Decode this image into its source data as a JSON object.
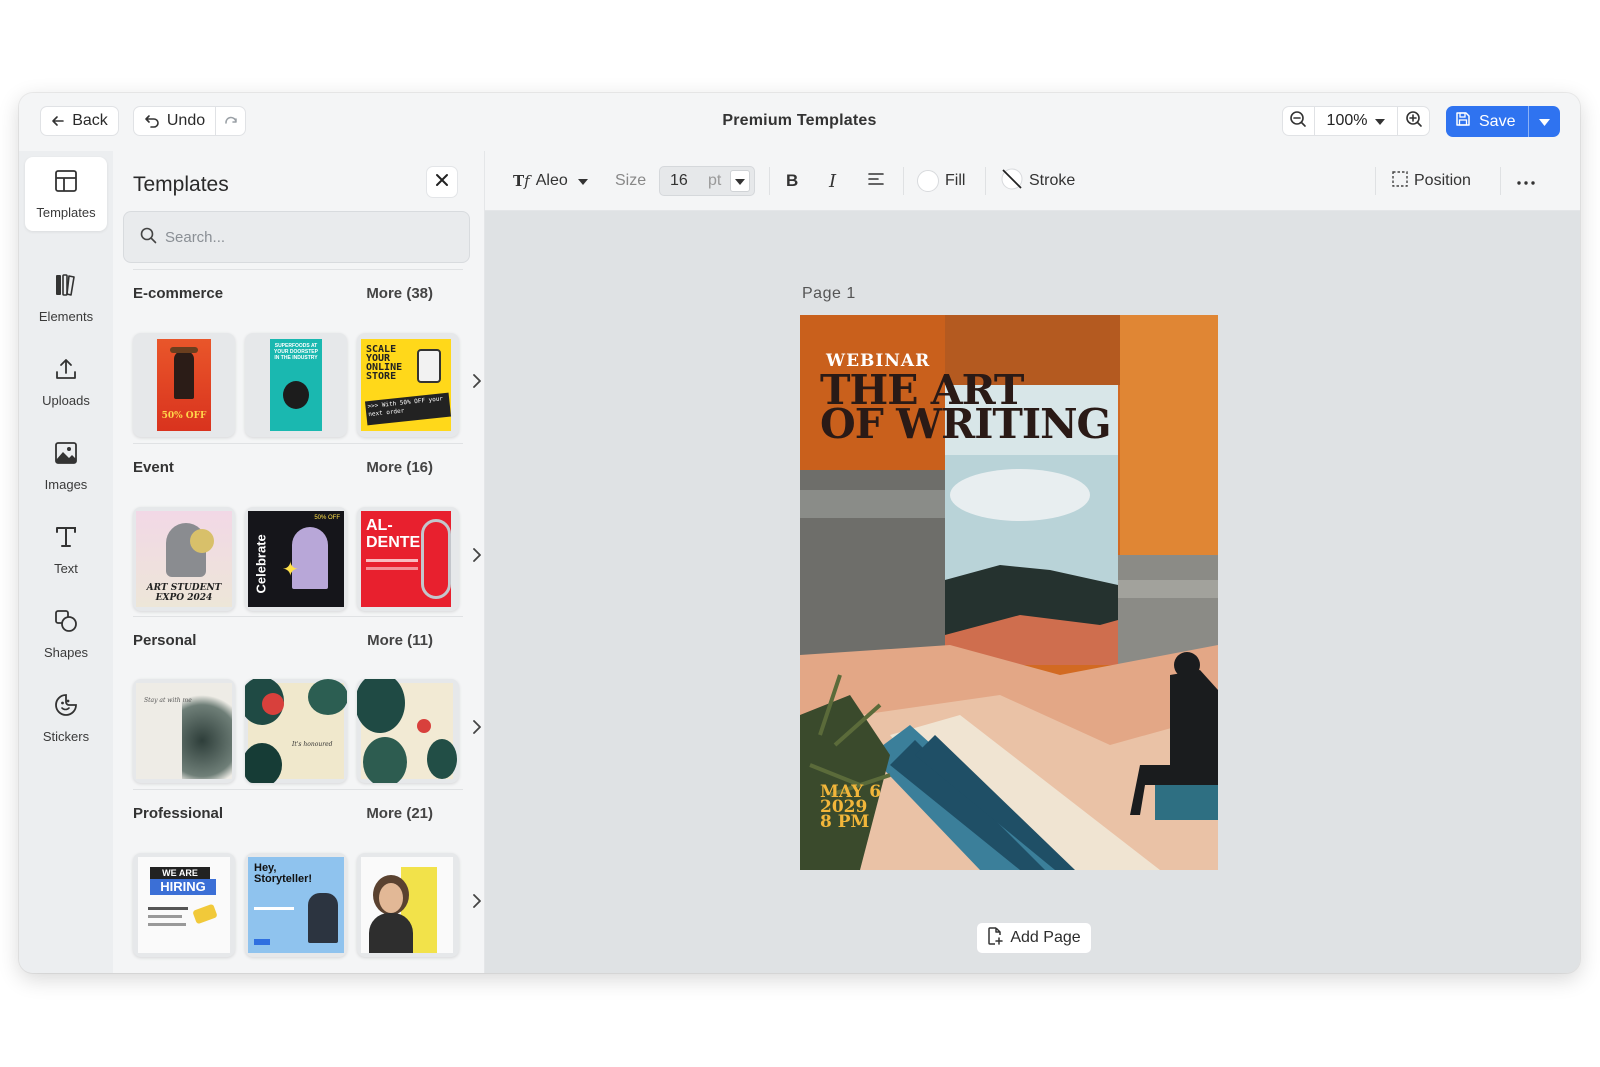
{
  "app": {
    "title": "Premium Templates",
    "back_label": "Back",
    "undo_label": "Undo",
    "zoom_value": "100%",
    "save_label": "Save",
    "accent_color": "#2f73f0"
  },
  "rail": {
    "items": [
      {
        "label": "Templates",
        "icon": "layout-icon",
        "active": true
      },
      {
        "label": "Elements",
        "icon": "elements-icon"
      },
      {
        "label": "Uploads",
        "icon": "upload-icon"
      },
      {
        "label": "Images",
        "icon": "image-icon"
      },
      {
        "label": "Text",
        "icon": "text-icon"
      },
      {
        "label": "Shapes",
        "icon": "shapes-icon"
      },
      {
        "label": "Stickers",
        "icon": "sticker-icon"
      }
    ]
  },
  "panel": {
    "title": "Templates",
    "search_placeholder": "Search...",
    "sections": [
      {
        "name": "E-commerce",
        "more": "More (38)",
        "thumbs": [
          {
            "text": "50% OFF"
          },
          {
            "text": "SUPERFOODS AT YOUR DOORSTEP IN THE INDUSTRY"
          },
          {
            "text": "SCALE YOUR ONLINE STORE",
            "sub": ">>> With 50% OFF your next order"
          }
        ]
      },
      {
        "name": "Event",
        "more": "More (16)",
        "thumbs": [
          {
            "text": "ART STUDENT EXPO 2024"
          },
          {
            "text": "Celebrate",
            "sub": "50% OFF"
          },
          {
            "text": "AL-DENTE"
          }
        ]
      },
      {
        "name": "Personal",
        "more": "More (11)",
        "thumbs": [
          {
            "text": "Stay at with me"
          },
          {
            "text": "It's honoured"
          },
          {
            "text": ""
          }
        ]
      },
      {
        "name": "Professional",
        "more": "More (21)",
        "thumbs": [
          {
            "text": "WE ARE",
            "sub": "HIRING"
          },
          {
            "text": "Hey, Storyteller!"
          },
          {
            "text": ""
          }
        ]
      }
    ]
  },
  "format_toolbar": {
    "font_name": "Aleo",
    "size_label": "Size",
    "size_value": "16",
    "size_unit": "pt",
    "fill_label": "Fill",
    "stroke_label": "Stroke",
    "position_label": "Position"
  },
  "canvas": {
    "page_label": "Page  1",
    "add_page_label": "Add Page",
    "poster": {
      "kicker": "WEBINAR",
      "title_line1": "THE ART",
      "title_line2": "OF WRITING",
      "date_line1": "MAY 6",
      "date_line2": "2029",
      "date_line3": "8 PM"
    }
  }
}
